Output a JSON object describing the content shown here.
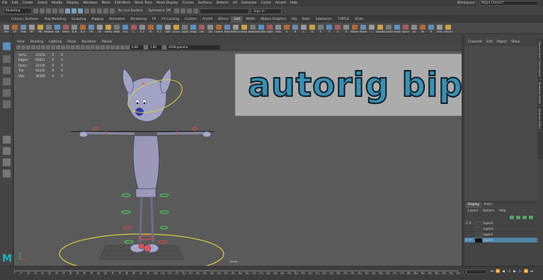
{
  "menubar": {
    "items": [
      "File",
      "Edit",
      "Create",
      "Select",
      "Modify",
      "Display",
      "Windows",
      "Mesh",
      "Edit Mesh",
      "Mesh Tools",
      "Mesh Display",
      "Curves",
      "Surfaces",
      "Deform",
      "UV",
      "Generate",
      "Cache",
      "Arnold",
      "Help"
    ],
    "workspace_label": "Workspace :",
    "workspace_value": "Maya Classic*"
  },
  "statusline": {
    "mode": "Modeling",
    "live_surface": "No Live Surface",
    "symmetry": "Symmetry: Off",
    "signin": "Sign In"
  },
  "shelf": {
    "tabs": [
      "Curves / Surfaces",
      "Poly Modeling",
      "Sculpting",
      "Rigging",
      "Animation",
      "Rendering",
      "FX",
      "FX Caching",
      "Custom",
      "Arnold",
      "Bifrost",
      "Gait",
      "MASH",
      "Motion Graphics",
      "Rig",
      "Bake",
      "Substance",
      "TURTLE",
      "XGen"
    ],
    "active_tab": "Gait",
    "buttons": [
      "Hist",
      "CP",
      "Hide",
      "MT",
      "MB",
      "Rename",
      "Hdr",
      "Name",
      "N_N",
      "N_S",
      "MG",
      "All",
      "CtrlSty",
      "offset",
      "Grp",
      "C_",
      "C_C",
      "PL",
      "P_C",
      "Split",
      "JCurve",
      "CopyS",
      "sCopy",
      "LRA",
      "Ctls",
      "Launch",
      "RAUL",
      "MultiCurv",
      "Snap",
      "BakeOn",
      "TrackFix",
      "Scale",
      "Help",
      "A",
      "B",
      "C",
      "D",
      "E",
      "F",
      "G",
      "H",
      "AltSym",
      "Parent",
      "J",
      "ShowAll",
      "LockAll",
      "Unlock",
      "Space",
      "Vp",
      "Ds",
      "R",
      "ortrs",
      "ctrlCurs"
    ]
  },
  "viewport": {
    "menu": [
      "View",
      "Shading",
      "Lighting",
      "Show",
      "Renderer",
      "Panels"
    ],
    "near_field": "0.00",
    "far_field": "1.00",
    "colorspace": "sRGB gamma",
    "camera": "persp",
    "hud": {
      "rows": [
        {
          "label": "Verts:",
          "a": "31110",
          "b": "0",
          "c": "0"
        },
        {
          "label": "Edges:",
          "a": "62011",
          "b": "0",
          "c": "0"
        },
        {
          "label": "Faces:",
          "a": "31116",
          "b": "0",
          "c": "0"
        },
        {
          "label": "Tris:",
          "a": "62132",
          "b": "0",
          "c": "0"
        },
        {
          "label": "UVs:",
          "a": "36339",
          "b": "0",
          "c": "0"
        }
      ]
    }
  },
  "overlay": {
    "title": "autorig biped"
  },
  "channelbox": {
    "menu": [
      "Channels",
      "Edit",
      "Object",
      "Show"
    ],
    "side_tabs": [
      "Channel Box / Layer Editor",
      "Modeling Toolkit",
      "Attribute Editor"
    ]
  },
  "layers": {
    "tabs": [
      "Display",
      "Anim"
    ],
    "active_tab": "Display",
    "menu": [
      "Layers",
      "Options",
      "Help"
    ],
    "rows": [
      {
        "v": "V",
        "p": "P",
        "name": "layer4",
        "selected": false,
        "swatch": "blank"
      },
      {
        "v": "",
        "p": "",
        "name": "layer3",
        "selected": false,
        "swatch": "blank"
      },
      {
        "v": "",
        "p": "",
        "name": "layer2",
        "selected": false,
        "swatch": "blank"
      },
      {
        "v": "V",
        "p": "P",
        "name": "layer1",
        "selected": true,
        "swatch": "dark"
      }
    ]
  },
  "timeline": {
    "labels": [
      "5",
      "10",
      "15",
      "20",
      "25",
      "30",
      "35",
      "40",
      "45",
      "50",
      "55",
      "60",
      "65",
      "70",
      "75",
      "80",
      "85",
      "90",
      "95",
      "100",
      "105",
      "110",
      "115",
      "120",
      "125",
      "130",
      "135",
      "140",
      "145",
      "150",
      "155",
      "160",
      "165",
      "170",
      "175",
      "180",
      "185",
      "190",
      "195",
      "200",
      "205",
      "210",
      "215",
      "220",
      "225",
      "230",
      "235",
      "240",
      "245",
      "250",
      "255",
      "260",
      "265",
      "270",
      "275",
      "280",
      "285",
      "290",
      "295",
      "300",
      "305",
      "310",
      "315"
    ],
    "current_frame": "1"
  },
  "logo": "M"
}
